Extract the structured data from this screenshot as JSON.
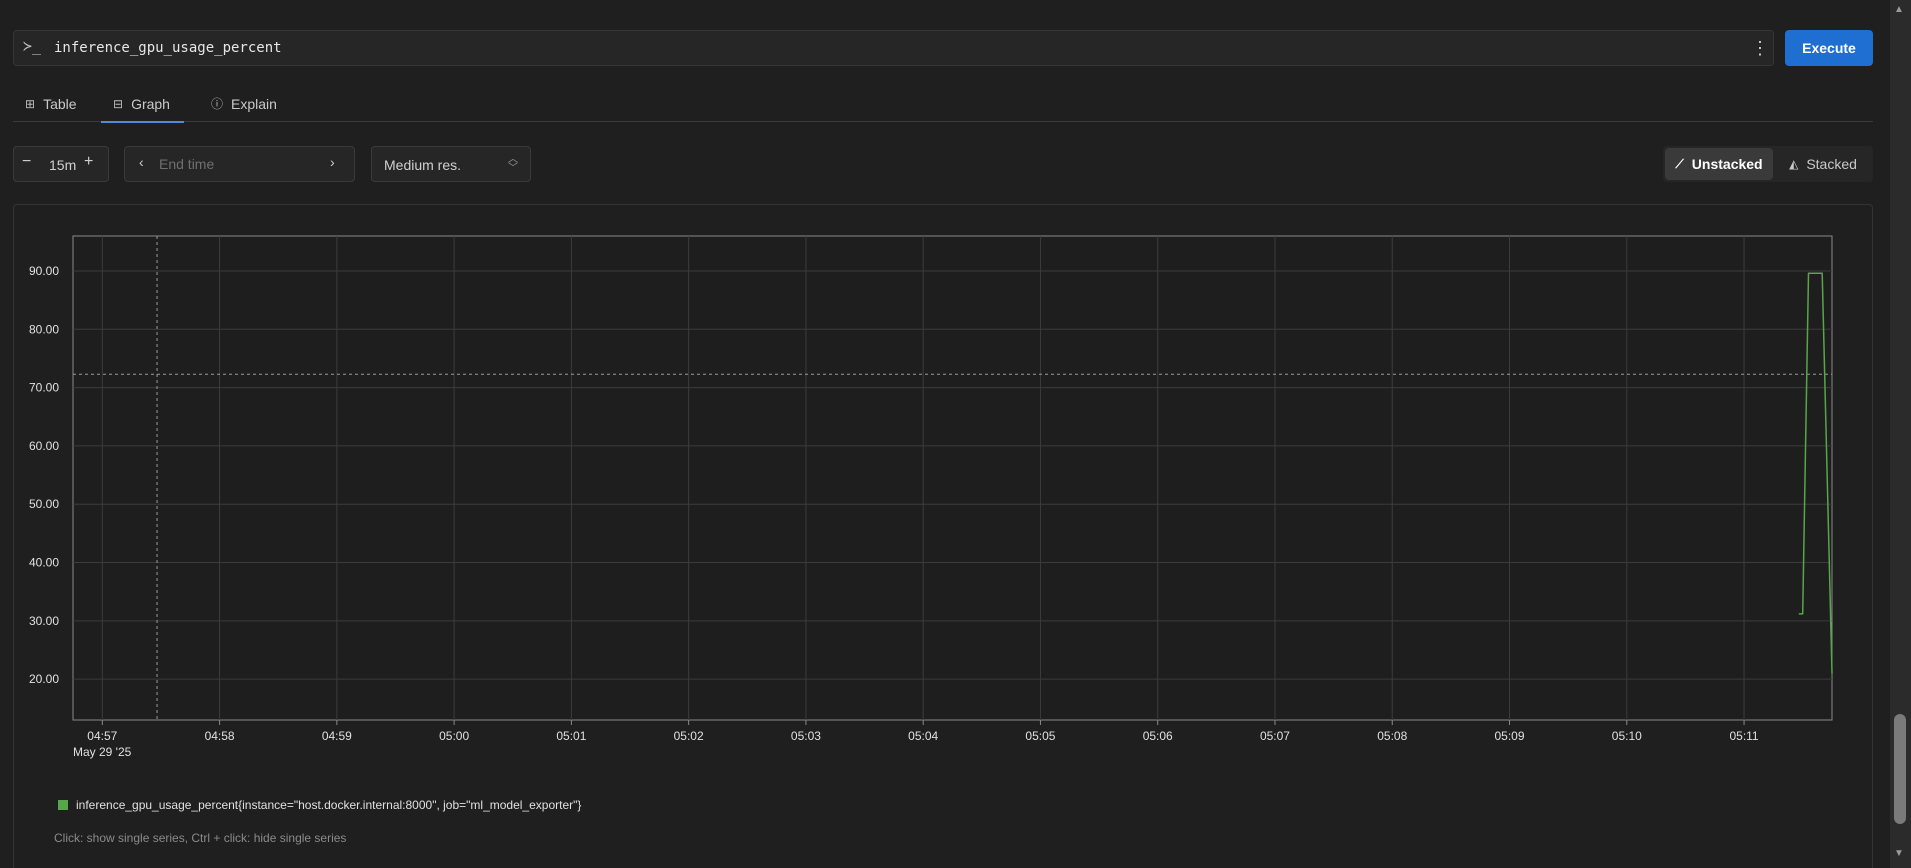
{
  "query": {
    "prompt_symbol": "≻_",
    "expression": "inference_gpu_usage_percent",
    "menu_symbol": "⋮",
    "execute_label": "Execute"
  },
  "tabs": [
    {
      "label": "Table",
      "icon": "table-icon",
      "icon_glyph": "⊞",
      "active": false
    },
    {
      "label": "Graph",
      "icon": "graph-icon",
      "icon_glyph": "⊟",
      "active": true
    },
    {
      "label": "Explain",
      "icon": "info-icon",
      "icon_glyph": "ⓘ",
      "active": false
    }
  ],
  "controls": {
    "range_value": "15m",
    "minus_symbol": "−",
    "plus_symbol": "+",
    "end_time_placeholder": "End time",
    "prev_symbol": "‹",
    "next_symbol": "›",
    "resolution": "Medium res.",
    "unstacked_label": "Unstacked",
    "stacked_label": "Stacked",
    "unstacked_icon": "line-chart-icon",
    "stacked_icon": "area-chart-icon"
  },
  "chart_data": {
    "type": "line",
    "x_tick_labels": [
      "04:57",
      "04:58",
      "04:59",
      "05:00",
      "05:01",
      "05:02",
      "05:03",
      "05:04",
      "05:05",
      "05:06",
      "05:07",
      "05:08",
      "05:09",
      "05:10",
      "05:11"
    ],
    "x_date_label": "May 29 '25",
    "x_range": [
      "04:56:45",
      "05:11:45"
    ],
    "y_tick_labels": [
      "90.00",
      "80.00",
      "70.00",
      "60.00",
      "50.00",
      "40.00",
      "30.00",
      "20.00"
    ],
    "ylim": [
      13,
      96
    ],
    "grid": true,
    "crosshair": {
      "x": "04:57:28",
      "y": 72.3
    },
    "series": [
      {
        "name": "inference_gpu_usage_percent{instance=\"host.docker.internal:8000\", job=\"ml_model_exporter\"}",
        "color": "#57a64a",
        "points": [
          [
            "05:11:28",
            31.2
          ],
          [
            "05:11:30",
            31.2
          ],
          [
            "05:11:33",
            89.6
          ],
          [
            "05:11:40",
            89.6
          ],
          [
            "05:11:45",
            21.0
          ]
        ]
      }
    ]
  },
  "hint": "Click: show single series, Ctrl + click: hide single series",
  "scroll_up_symbol": "▲",
  "scroll_down_symbol": "▼"
}
